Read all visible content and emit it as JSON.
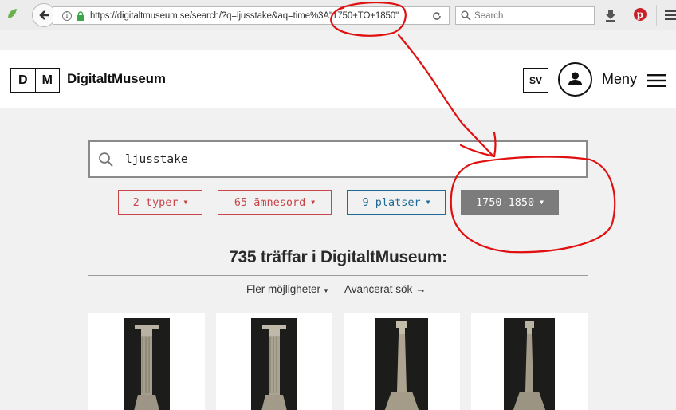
{
  "browser": {
    "url": "https://digitaltmuseum.se/search/?q=ljusstake&aq=time%3A\"1750+TO+1850\"",
    "search_placeholder": "Search"
  },
  "header": {
    "logo_left": "D",
    "logo_right": "M",
    "site_name": "DigitaltMuseum",
    "lang": "SV",
    "menu_label": "Meny"
  },
  "search": {
    "query": "ljusstake"
  },
  "filters": {
    "types": "2 typer",
    "topics": "65 ämnesord",
    "places": "9 platser",
    "time": "1750-1850"
  },
  "results": {
    "title": "735 träffar i DigitaltMuseum:",
    "more_options": "Fler möjligheter",
    "advanced": "Avancerat sök →"
  },
  "colors": {
    "filter_red": "#c8464c",
    "filter_blue": "#1f6a96",
    "filter_active": "#7c7c7c",
    "annotation": "#e01010"
  },
  "icons": {
    "back": "arrow-left-icon",
    "info": "info-icon",
    "lock": "lock-icon",
    "reload": "reload-icon",
    "search": "search-icon",
    "download": "download-icon",
    "pinterest": "pinterest-icon",
    "user": "user-icon",
    "menu": "hamburger-icon"
  }
}
